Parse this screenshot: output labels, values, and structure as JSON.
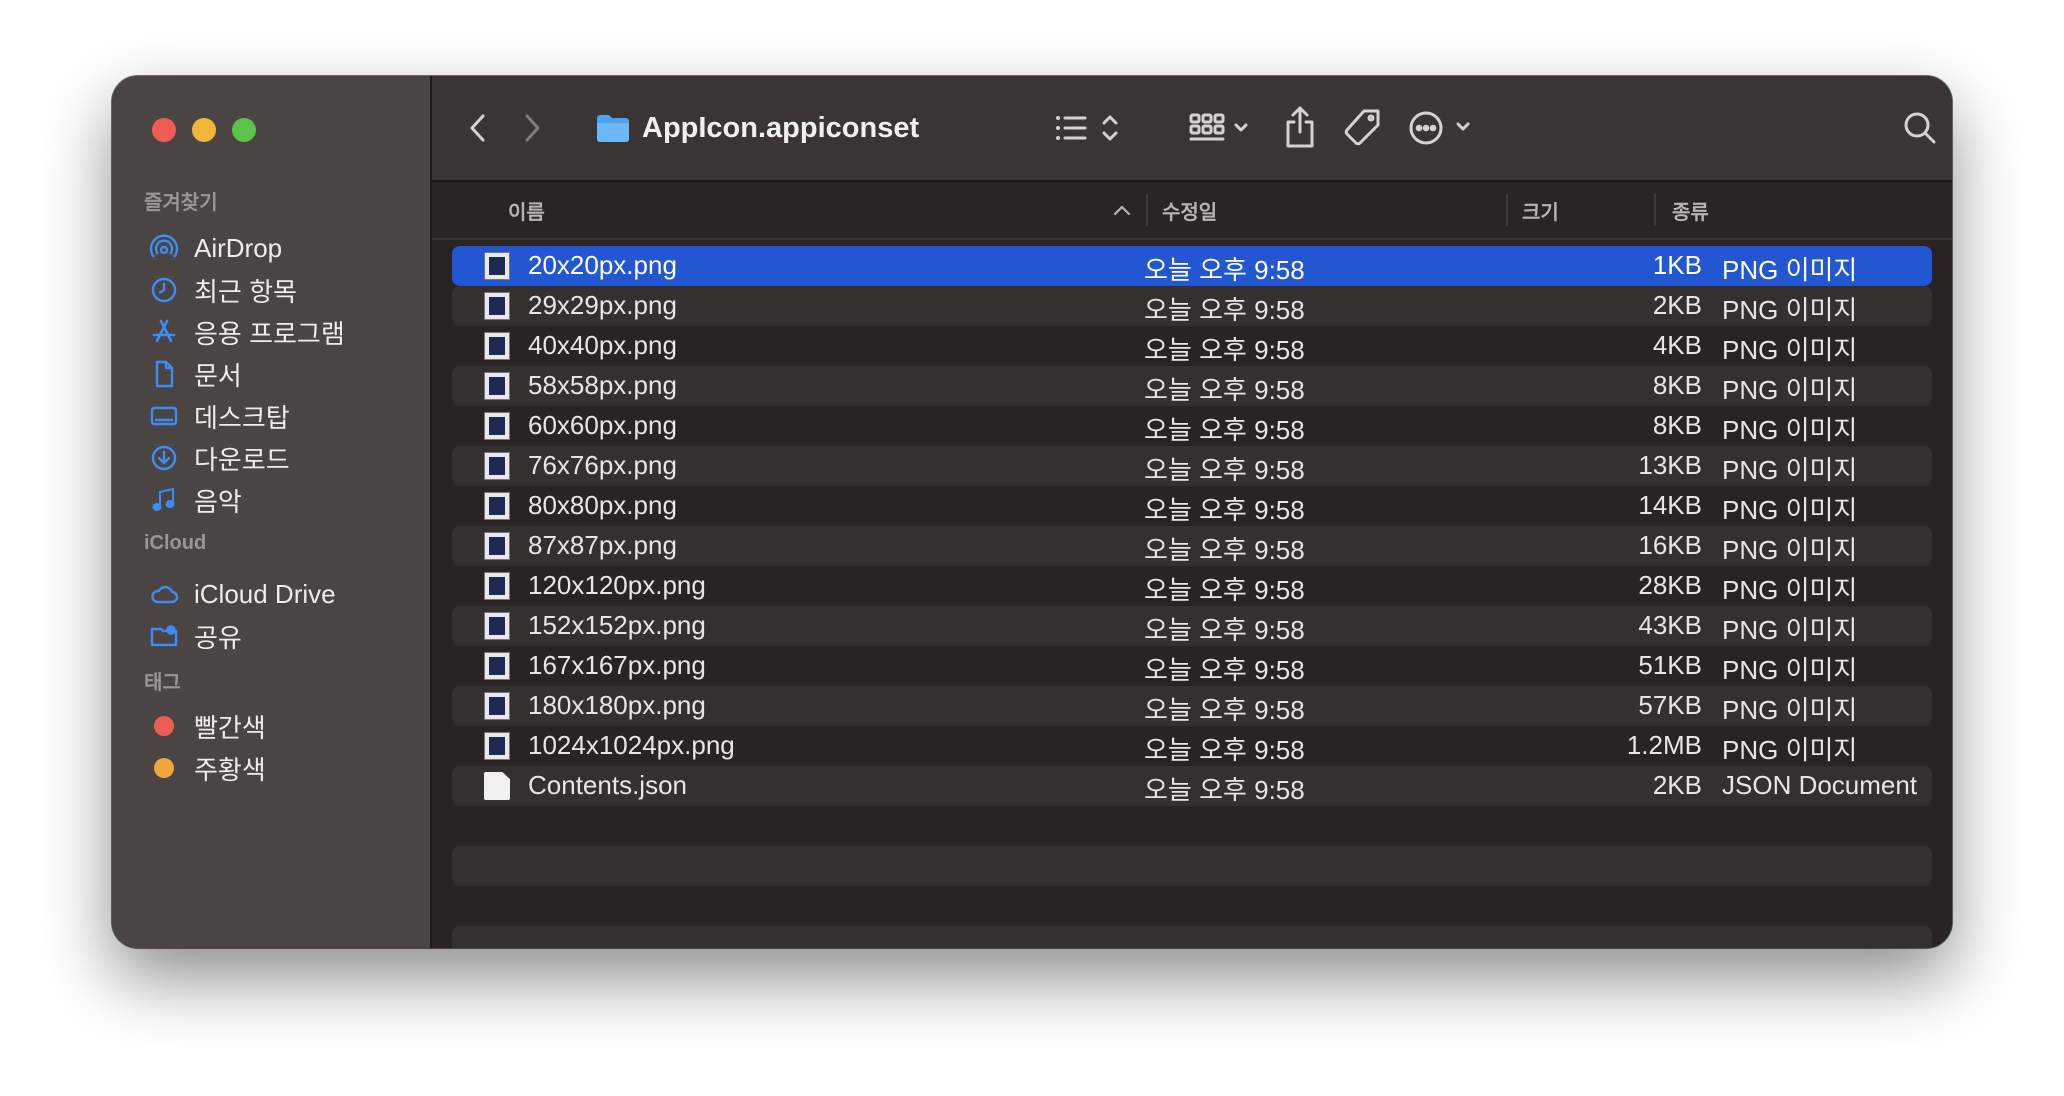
{
  "window": {
    "title": "AppIcon.appiconset"
  },
  "sidebar": {
    "favorites_heading": "즐겨찾기",
    "favorites": [
      {
        "label": "AirDrop",
        "icon": "airdrop-icon"
      },
      {
        "label": "최근 항목",
        "icon": "clock-icon"
      },
      {
        "label": "응용 프로그램",
        "icon": "applications-icon"
      },
      {
        "label": "문서",
        "icon": "document-icon"
      },
      {
        "label": "데스크탑",
        "icon": "desktop-icon"
      },
      {
        "label": "다운로드",
        "icon": "download-icon"
      },
      {
        "label": "음악",
        "icon": "music-icon"
      }
    ],
    "icloud_heading": "iCloud",
    "icloud": [
      {
        "label": "iCloud Drive",
        "icon": "cloud-icon"
      },
      {
        "label": "공유",
        "icon": "shared-folder-icon"
      }
    ],
    "tags_heading": "태그",
    "tags": [
      {
        "label": "빨간색",
        "color": "#ee5d55"
      },
      {
        "label": "주황색",
        "color": "#f2a63a"
      }
    ]
  },
  "columns": {
    "name": "이름",
    "date": "수정일",
    "size": "크기",
    "kind": "종류"
  },
  "files": [
    {
      "name": "20x20px.png",
      "date": "오늘 오후 9:58",
      "size": "1KB",
      "kind": "PNG 이미지",
      "selected": true
    },
    {
      "name": "29x29px.png",
      "date": "오늘 오후 9:58",
      "size": "2KB",
      "kind": "PNG 이미지"
    },
    {
      "name": "40x40px.png",
      "date": "오늘 오후 9:58",
      "size": "4KB",
      "kind": "PNG 이미지"
    },
    {
      "name": "58x58px.png",
      "date": "오늘 오후 9:58",
      "size": "8KB",
      "kind": "PNG 이미지"
    },
    {
      "name": "60x60px.png",
      "date": "오늘 오후 9:58",
      "size": "8KB",
      "kind": "PNG 이미지"
    },
    {
      "name": "76x76px.png",
      "date": "오늘 오후 9:58",
      "size": "13KB",
      "kind": "PNG 이미지"
    },
    {
      "name": "80x80px.png",
      "date": "오늘 오후 9:58",
      "size": "14KB",
      "kind": "PNG 이미지"
    },
    {
      "name": "87x87px.png",
      "date": "오늘 오후 9:58",
      "size": "16KB",
      "kind": "PNG 이미지"
    },
    {
      "name": "120x120px.png",
      "date": "오늘 오후 9:58",
      "size": "28KB",
      "kind": "PNG 이미지"
    },
    {
      "name": "152x152px.png",
      "date": "오늘 오후 9:58",
      "size": "43KB",
      "kind": "PNG 이미지"
    },
    {
      "name": "167x167px.png",
      "date": "오늘 오후 9:58",
      "size": "51KB",
      "kind": "PNG 이미지"
    },
    {
      "name": "180x180px.png",
      "date": "오늘 오후 9:58",
      "size": "57KB",
      "kind": "PNG 이미지"
    },
    {
      "name": "1024x1024px.png",
      "date": "오늘 오후 9:58",
      "size": "1.2MB",
      "kind": "PNG 이미지"
    },
    {
      "name": "Contents.json",
      "date": "오늘 오후 9:58",
      "size": "2KB",
      "kind": "JSON Document",
      "type": "json"
    }
  ],
  "toolbar": {
    "back_icon": "chevron-left-icon",
    "forward_icon": "chevron-right-icon",
    "view_list_icon": "list-view-icon",
    "group_icon": "grid-group-icon",
    "share_icon": "share-icon",
    "tag_icon": "tag-icon",
    "more_icon": "ellipsis-circle-icon",
    "search_icon": "search-icon"
  }
}
